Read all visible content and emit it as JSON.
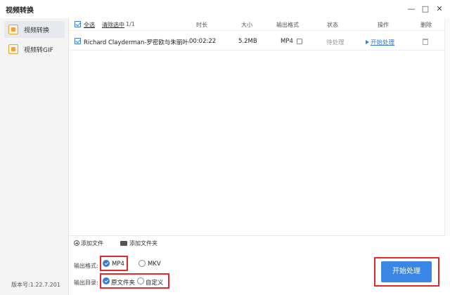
{
  "window": {
    "title": "视频转换",
    "minimize": "—",
    "maximize": "□",
    "close": "✕"
  },
  "sidebar": {
    "items": [
      {
        "label": "视频转换",
        "active": true,
        "icon": "video-convert-icon"
      },
      {
        "label": "视频转GIF",
        "active": false,
        "icon": "gif-icon"
      }
    ],
    "version": "版本号:1.22.7.201"
  },
  "list": {
    "header": {
      "select_all": "全选",
      "clear_selected": "清除选中",
      "count": "1/1",
      "duration": "时长",
      "size": "大小",
      "output_format": "输出格式",
      "status": "状态",
      "action": "操作",
      "delete": "删除"
    },
    "rows": [
      {
        "name": "Richard Clayderman-罗密欧与朱丽叶(...",
        "duration": "00:02:22",
        "size": "5.2MB",
        "format": "MP4",
        "status": "待处理",
        "action": "开始处理"
      }
    ]
  },
  "toolbar": {
    "add_file": "添加文件",
    "add_folder": "添加文件夹"
  },
  "options": {
    "format_label": "输出格式:",
    "formats": [
      "MP4",
      "MKV"
    ],
    "selected_format": "MP4",
    "dir_label": "输出目录:",
    "dirs": [
      "原文件夹",
      "自定义"
    ],
    "selected_dir": "原文件夹"
  },
  "start_button": "开始处理",
  "colors": {
    "accent": "#3a86e6",
    "highlight": "#e5262d"
  }
}
